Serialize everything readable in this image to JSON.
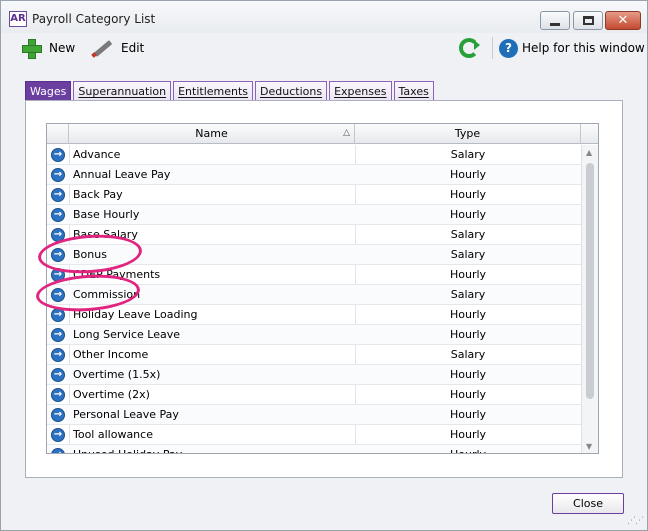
{
  "window": {
    "app_badge": "AR",
    "title": "Payroll Category List",
    "controls": {
      "minimize": "",
      "maximize": "",
      "close": "✕"
    }
  },
  "toolbar": {
    "new_label": "New",
    "edit_label": "Edit",
    "help_label": "Help for this window"
  },
  "tabs": [
    {
      "label": "Wages",
      "active": true
    },
    {
      "label": "Superannuation"
    },
    {
      "label": "Entitlements"
    },
    {
      "label": "Deductions"
    },
    {
      "label": "Expenses"
    },
    {
      "label": "Taxes"
    }
  ],
  "grid": {
    "columns": {
      "name": "Name",
      "type": "Type",
      "sort_indicator": "△"
    },
    "rows": [
      {
        "name": "Advance",
        "type": "Salary"
      },
      {
        "name": "Annual Leave Pay",
        "type": "Hourly"
      },
      {
        "name": "Back Pay",
        "type": "Hourly"
      },
      {
        "name": "Base Hourly",
        "type": "Hourly"
      },
      {
        "name": "Base Salary",
        "type": "Salary"
      },
      {
        "name": "Bonus",
        "type": "Salary"
      },
      {
        "name": "CDEP Payments",
        "type": "Hourly"
      },
      {
        "name": "Commission",
        "type": "Salary"
      },
      {
        "name": "Holiday Leave Loading",
        "type": "Hourly"
      },
      {
        "name": "Long Service Leave",
        "type": "Hourly"
      },
      {
        "name": "Other Income",
        "type": "Salary"
      },
      {
        "name": "Overtime (1.5x)",
        "type": "Hourly"
      },
      {
        "name": "Overtime (2x)",
        "type": "Hourly"
      },
      {
        "name": "Personal Leave Pay",
        "type": "Hourly"
      },
      {
        "name": "Tool allowance",
        "type": "Hourly"
      },
      {
        "name": "Unused Holiday Pay",
        "type": "Hourly"
      }
    ]
  },
  "footer": {
    "close_label": "Close"
  },
  "colors": {
    "accent": "#6b3fa0",
    "highlight_marker": "#e0247f",
    "row_icon": "#2d72c2"
  }
}
